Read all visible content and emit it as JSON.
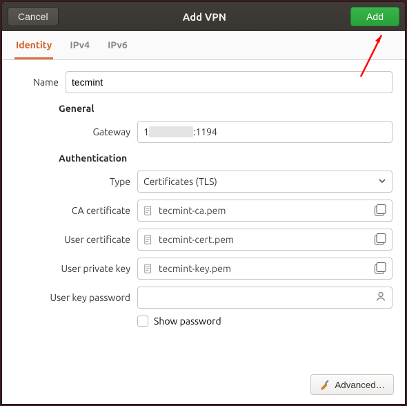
{
  "titlebar": {
    "cancel": "Cancel",
    "title": "Add VPN",
    "add": "Add"
  },
  "tabs": {
    "identity": "Identity",
    "ipv4": "IPv4",
    "ipv6": "IPv6"
  },
  "form": {
    "name_label": "Name",
    "name_value": "tecmint",
    "general_heading": "General",
    "gateway_label": "Gateway",
    "gateway_prefix": "1",
    "gateway_suffix": ":1194",
    "auth_heading": "Authentication",
    "type_label": "Type",
    "type_value": "Certificates (TLS)",
    "ca_label": "CA certificate",
    "ca_value": "tecmint-ca.pem",
    "ucert_label": "User certificate",
    "ucert_value": "tecmint-cert.pem",
    "ukey_label": "User private key",
    "ukey_value": "tecmint-key.pem",
    "pw_label": "User key password",
    "pw_value": "",
    "show_pw": "Show password"
  },
  "footer": {
    "advanced": "Advanced…"
  }
}
